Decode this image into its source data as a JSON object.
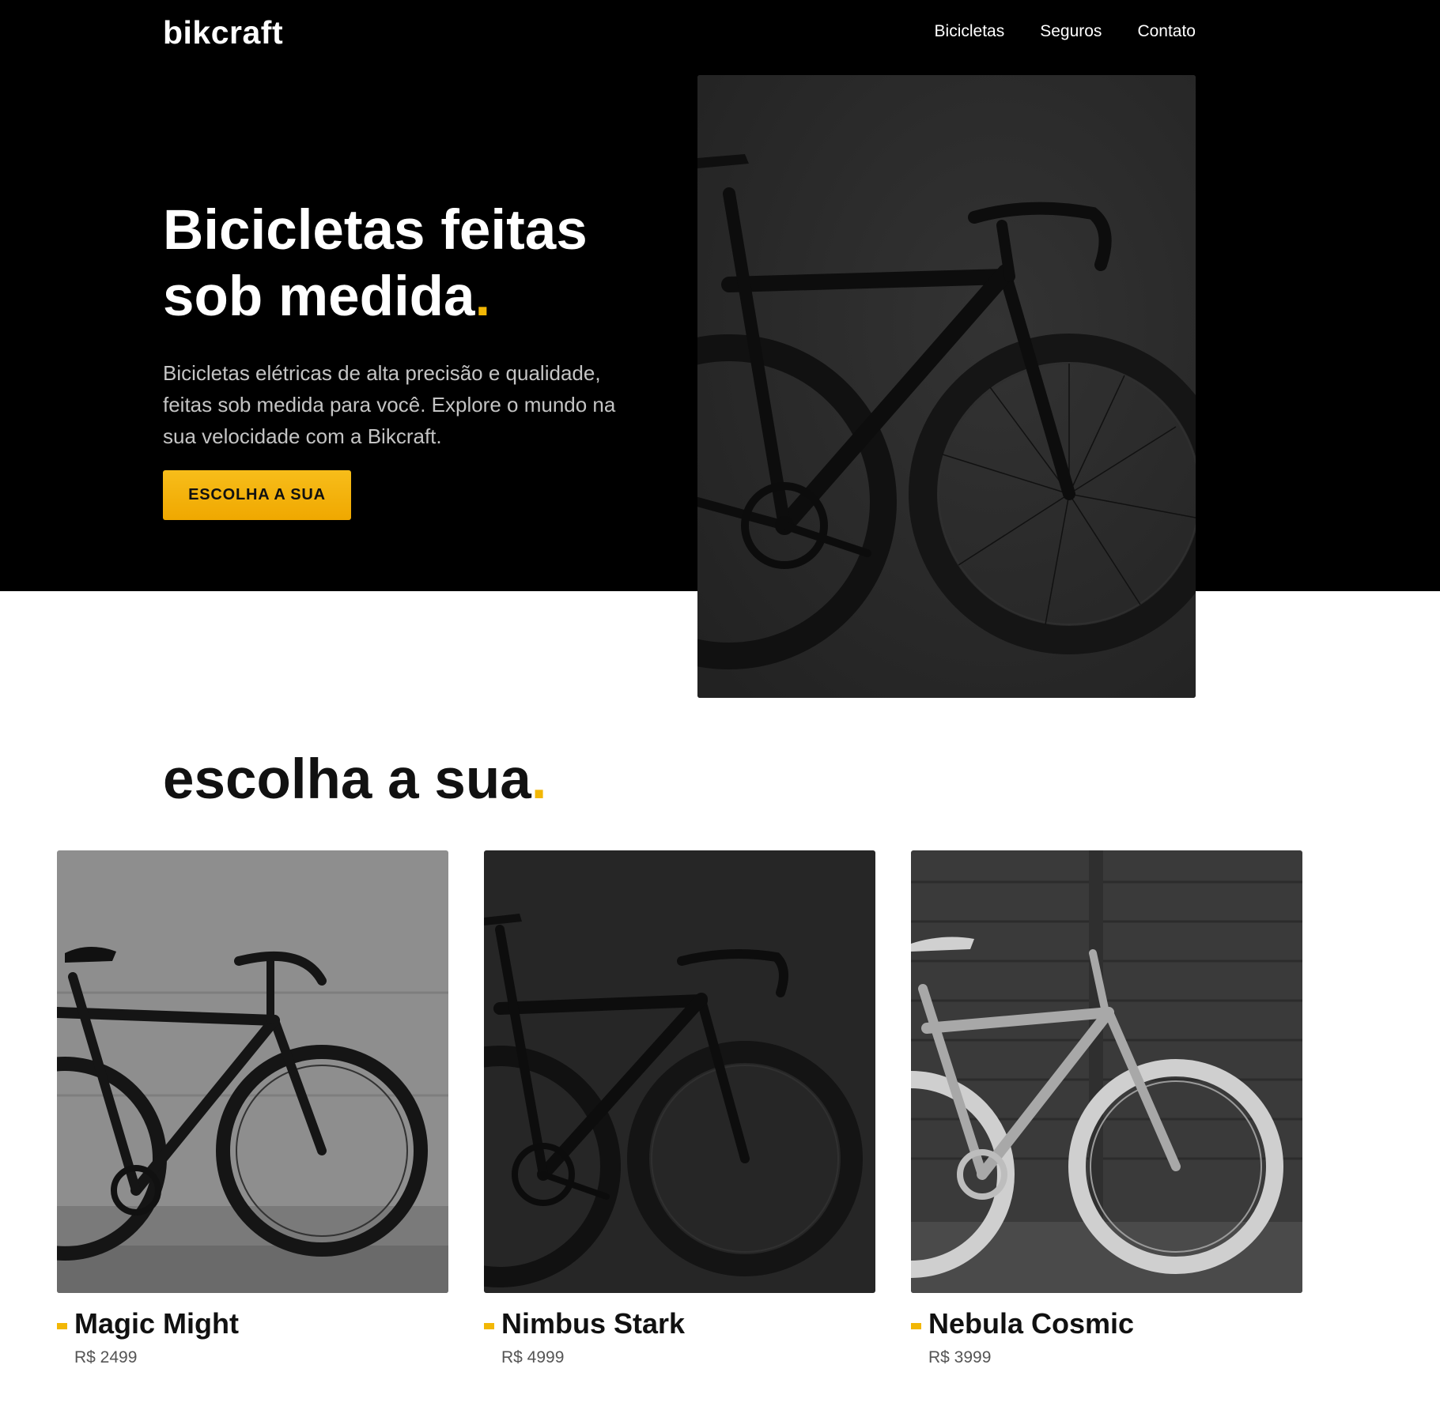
{
  "header": {
    "logo": "bikcraft",
    "nav": [
      "Bicicletas",
      "Seguros",
      "Contato"
    ]
  },
  "hero": {
    "title_main": "Bicicletas feitas sob medida",
    "title_dot": ".",
    "text": "Bicicletas elétricas de alta precisão e qualidade, feitas sob medida para você. Explore o mundo na sua velocidade com a Bikcraft.",
    "button": "ESCOLHA A SUA"
  },
  "products": {
    "title_main": "escolha a sua",
    "title_dot": ".",
    "items": [
      {
        "name": "Magic Might",
        "price": "R$ 2499"
      },
      {
        "name": "Nimbus Stark",
        "price": "R$ 4999"
      },
      {
        "name": "Nebula Cosmic",
        "price": "R$ 3999"
      }
    ]
  },
  "colors": {
    "accent": "#f2b705",
    "background_dark": "#000000",
    "text_dark": "#111111"
  },
  "icons": [
    "bike-photo-road-black",
    "bike-photo-fixie-black",
    "bike-photo-fixie-grey"
  ]
}
